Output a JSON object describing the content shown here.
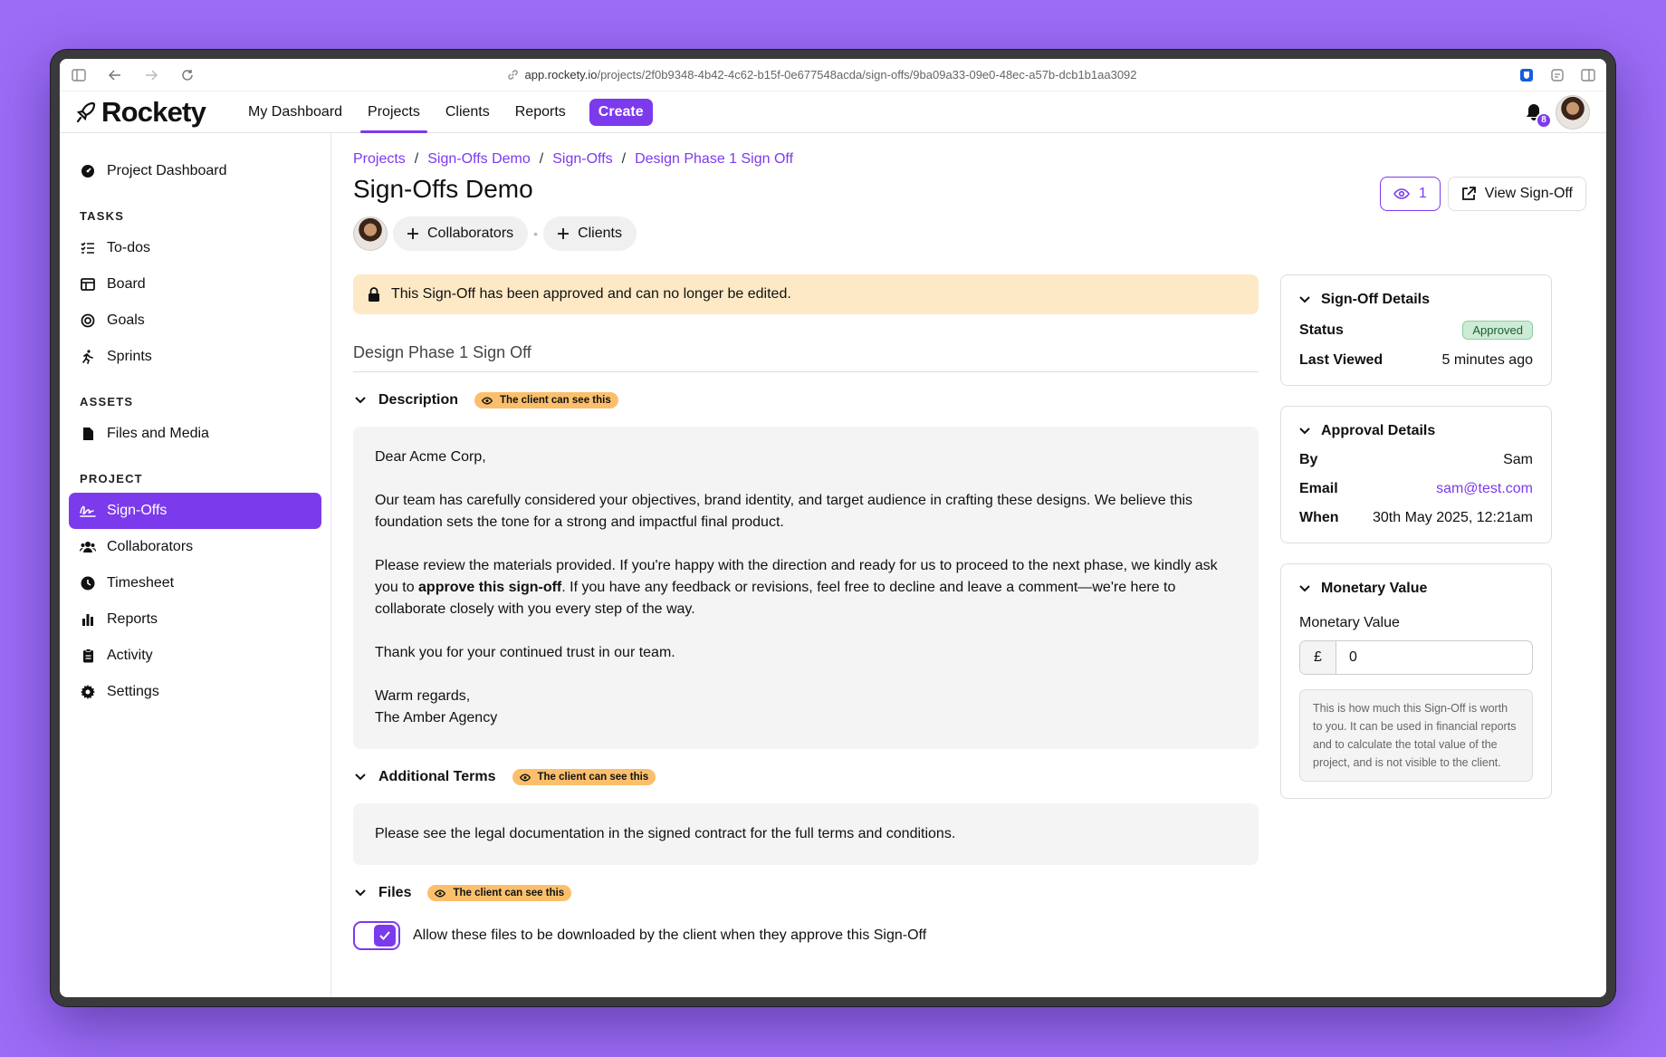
{
  "browser": {
    "url_host": "app.rockety.io",
    "url_path": "/projects/2f0b9348-4b42-4c62-b15f-0e677548acda/sign-offs/9ba09a33-09e0-48ec-a57b-dcb1b1aa3092"
  },
  "header": {
    "logo": "Rockety",
    "nav": [
      "My Dashboard",
      "Projects",
      "Clients",
      "Reports"
    ],
    "create_label": "Create",
    "notification_count": "8"
  },
  "sidebar": {
    "top_item": "Project Dashboard",
    "tasks_heading": "TASKS",
    "tasks": [
      "To-dos",
      "Board",
      "Goals",
      "Sprints"
    ],
    "assets_heading": "ASSETS",
    "assets": [
      "Files and Media"
    ],
    "project_heading": "PROJECT",
    "project": [
      "Sign-Offs",
      "Collaborators",
      "Timesheet",
      "Reports",
      "Activity",
      "Settings"
    ]
  },
  "breadcrumb": [
    "Projects",
    "Sign-Offs Demo",
    "Sign-Offs",
    "Design Phase 1 Sign Off"
  ],
  "page_title": "Sign-Offs Demo",
  "watchers_count": "1",
  "view_signoff_label": "View Sign-Off",
  "collaborators_label": "Collaborators",
  "clients_label": "Clients",
  "locked_message": "This Sign-Off has been approved and can no longer be edited.",
  "doc_title": "Design Phase 1 Sign Off",
  "visibility_badge": "The client can see this",
  "description": {
    "label": "Description",
    "greeting": "Dear Acme Corp,",
    "para1": "Our team has carefully considered your objectives, brand identity, and target audience in crafting these designs. We believe this foundation sets the tone for a strong and impactful final product.",
    "para2_a": "Please review the materials provided. If you're happy with the direction and ready for us to proceed to the next phase, we kindly ask you to ",
    "para2_bold": "approve this sign-off",
    "para2_b": ". If you have any feedback or revisions, feel free to decline and leave a comment—we're here to collaborate closely with you every step of the way.",
    "para3": "Thank you for your continued trust in our team.",
    "closing": "Warm regards,",
    "signature": "The Amber Agency"
  },
  "additional_terms": {
    "label": "Additional Terms",
    "text": "Please see the legal documentation in the signed contract for the full terms and conditions."
  },
  "files": {
    "label": "Files",
    "toggle_label": "Allow these files to be downloaded by the client when they approve this Sign-Off"
  },
  "signoff_details": {
    "title": "Sign-Off Details",
    "status_label": "Status",
    "status_value": "Approved",
    "viewed_label": "Last Viewed",
    "viewed_value": "5 minutes ago"
  },
  "approval_details": {
    "title": "Approval Details",
    "by_label": "By",
    "by_value": "Sam",
    "email_label": "Email",
    "email_value": "sam@test.com",
    "when_label": "When",
    "when_value": "30th May 2025, 12:21am"
  },
  "monetary": {
    "title": "Monetary Value",
    "field_label": "Monetary Value",
    "currency": "£",
    "value": "0",
    "help": "This is how much this Sign-Off is worth to you. It can be used in financial reports and to calculate the total value of the project, and is not visible to the client."
  },
  "colors": {
    "accent": "#7c3aed",
    "banner": "#fde9c6",
    "badge": "#fbbf6c",
    "background": "#9b6cf6"
  }
}
